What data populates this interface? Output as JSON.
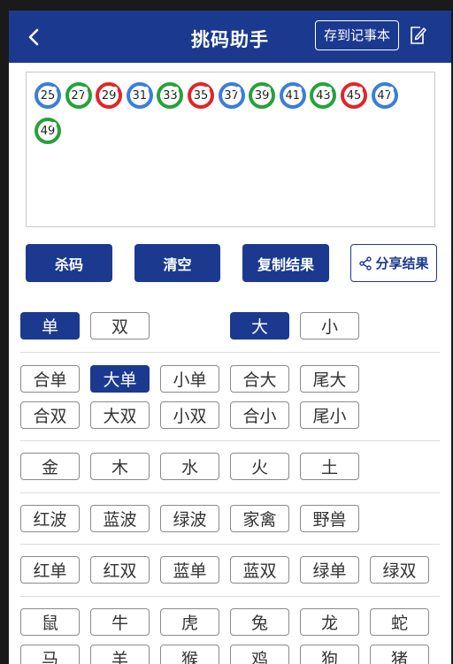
{
  "header": {
    "title": "挑码助手",
    "save_label": "存到记事本"
  },
  "balls": [
    {
      "num": "25",
      "color": "blue"
    },
    {
      "num": "27",
      "color": "green"
    },
    {
      "num": "29",
      "color": "red"
    },
    {
      "num": "31",
      "color": "blue"
    },
    {
      "num": "33",
      "color": "green"
    },
    {
      "num": "35",
      "color": "red"
    },
    {
      "num": "37",
      "color": "blue"
    },
    {
      "num": "39",
      "color": "green"
    },
    {
      "num": "41",
      "color": "blue"
    },
    {
      "num": "43",
      "color": "green"
    },
    {
      "num": "45",
      "color": "red"
    },
    {
      "num": "47",
      "color": "blue"
    },
    {
      "num": "49",
      "color": "green"
    }
  ],
  "actions": {
    "kill": "杀码",
    "clear": "清空",
    "copy": "复制结果",
    "share": "分享结果"
  },
  "row_odd_even": [
    "单",
    "双"
  ],
  "row_big_small": [
    "大",
    "小"
  ],
  "row_combo1": [
    "合单",
    "大单",
    "小单",
    "合大",
    "尾大"
  ],
  "row_combo2": [
    "合双",
    "大双",
    "小双",
    "合小",
    "尾小"
  ],
  "row_elements": [
    "金",
    "木",
    "水",
    "火",
    "土"
  ],
  "row_waves": [
    "红波",
    "蓝波",
    "绿波",
    "家禽",
    "野兽"
  ],
  "row_wave_parity": [
    "红单",
    "红双",
    "蓝单",
    "蓝双",
    "绿单",
    "绿双"
  ],
  "row_zodiac1": [
    "鼠",
    "牛",
    "虎",
    "兔",
    "龙",
    "蛇"
  ],
  "row_zodiac2": [
    "马",
    "羊",
    "猴",
    "鸡",
    "狗",
    "猪"
  ],
  "selected": [
    "单",
    "大",
    "大单"
  ],
  "colors": {
    "primary": "#1b3a8f",
    "ball_blue": "#3a7fd6",
    "ball_green": "#25a23a",
    "ball_red": "#e0262b"
  }
}
